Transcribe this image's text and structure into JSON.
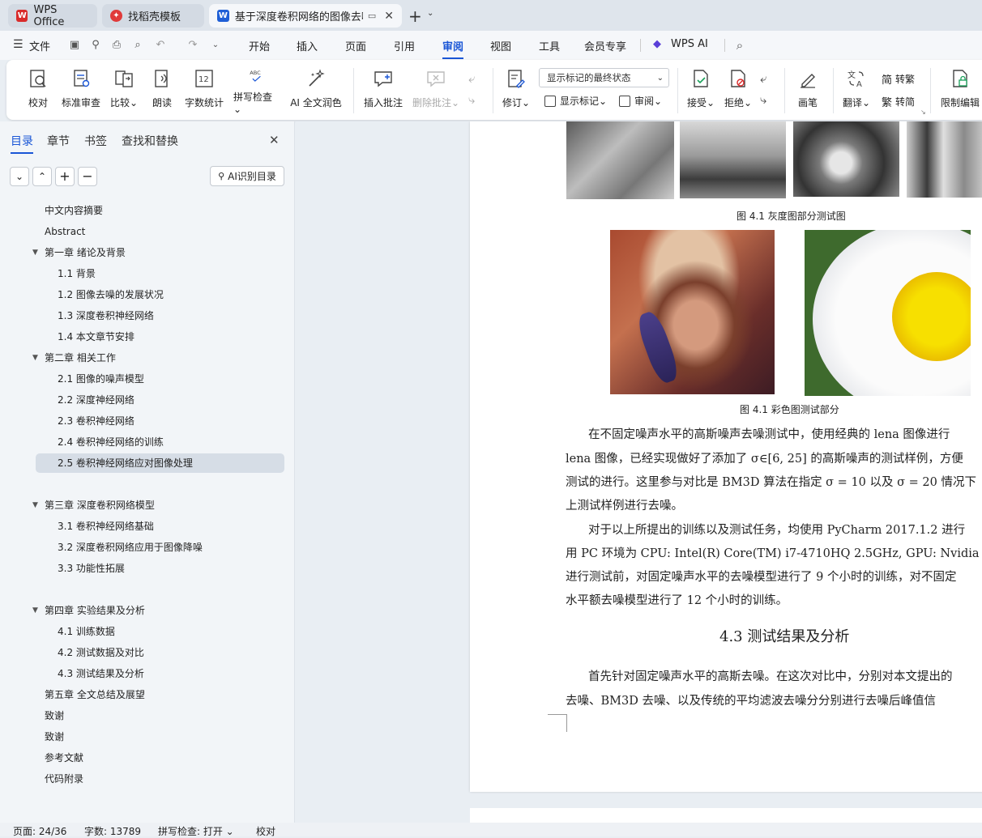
{
  "tabs": [
    {
      "label": "WPS Office",
      "icon": "wps-logo",
      "color": "#d92b2b"
    },
    {
      "label": "找稻壳模板",
      "icon": "docer-logo",
      "color": "#e03a3a"
    },
    {
      "label": "基于深度卷积网络的图像去噪",
      "icon": "word-logo",
      "color": "#1f5fd6"
    }
  ],
  "menu": {
    "file": "文件",
    "items": [
      "开始",
      "插入",
      "页面",
      "引用",
      "审阅",
      "视图",
      "工具",
      "会员专享"
    ],
    "selected": "审阅",
    "wps_ai": "WPS AI"
  },
  "ribbon": {
    "buttons": [
      "校对",
      "标准审查",
      "比较",
      "朗读",
      "字数统计",
      "拼写检查",
      "AI 全文润色",
      "插入批注",
      "删除批注",
      "修订",
      "画笔",
      "翻译",
      "限制编辑"
    ],
    "dropdown": "显示标记的最终状态",
    "small": [
      "显示标记",
      "审阅",
      "接受",
      "拒绝",
      "转繁",
      "转简"
    ]
  },
  "panel": {
    "tabs": [
      "目录",
      "章节",
      "书签",
      "查找和替换"
    ],
    "ai_button": "AI识别目录",
    "toc": [
      {
        "text": "中文内容摘要",
        "level": 1,
        "expand": false
      },
      {
        "text": "Abstract",
        "level": 1,
        "expand": false
      },
      {
        "text": "第一章  绪论及背景",
        "level": 1,
        "expand": true
      },
      {
        "text": "1.1 背景",
        "level": 2
      },
      {
        "text": "1.2  图像去噪的发展状况",
        "level": 2
      },
      {
        "text": "1.3  深度卷积神经网络",
        "level": 2
      },
      {
        "text": "1.4  本文章节安排",
        "level": 2
      },
      {
        "text": "第二章  相关工作",
        "level": 1,
        "expand": true
      },
      {
        "text": "2.1 图像的噪声模型",
        "level": 2
      },
      {
        "text": "2.2 深度神经网络",
        "level": 2
      },
      {
        "text": "2.3 卷积神经网络",
        "level": 2
      },
      {
        "text": "2.4  卷积神经网络的训练",
        "level": 2
      },
      {
        "text": "2.5  卷积神经网络应对图像处理",
        "level": 2,
        "selected": true
      },
      {
        "text": "第三章  深度卷积网络模型",
        "level": 1,
        "expand": true
      },
      {
        "text": "3.1  卷积神经网络基础",
        "level": 2
      },
      {
        "text": "3.2  深度卷积网络应用于图像降噪",
        "level": 2
      },
      {
        "text": "3.3  功能性拓展",
        "level": 2
      },
      {
        "text": "第四章  实验结果及分析",
        "level": 1,
        "expand": true
      },
      {
        "text": "4.1  训练数据",
        "level": 2
      },
      {
        "text": "4.2  测试数据及对比",
        "level": 2
      },
      {
        "text": "4.3  测试结果及分析",
        "level": 2
      },
      {
        "text": "第五章  全文总结及展望",
        "level": 1,
        "expand": false
      },
      {
        "text": "致谢",
        "level": 1,
        "expand": false
      },
      {
        "text": "致谢",
        "level": 1,
        "expand": false
      },
      {
        "text": "参考文献",
        "level": 1,
        "expand": false
      },
      {
        "text": "代码附录",
        "level": 1,
        "expand": false
      }
    ]
  },
  "document": {
    "caption1": "图 4.1  灰度图部分测试图",
    "caption2": "图  4.1  彩色图测试部分",
    "paragraphs": [
      "在不固定噪声水平的高斯噪声去噪测试中，使用经典的 lena 图像进行",
      "lena 图像，已经实现做好了添加了 σ∈[6, 25] 的高斯噪声的测试样例，方便",
      "测试的进行。这里参与对比是 BM3D 算法在指定 σ = 10 以及 σ = 20 情况下",
      "上测试样例进行去噪。",
      "对于以上所提出的训练以及测试任务，均使用 PyCharm 2017.1.2 进行",
      "用 PC 环境为 CPU: Intel(R) Core(TM) i7-4710HQ 2.5GHz, GPU: Nvidia GTX",
      "进行测试前，对固定噪声水平的去噪模型进行了 9 个小时的训练，对不固定",
      "水平额去噪模型进行了 12 个小时的训练。",
      "首先针对固定噪声水平的高斯去噪。在这次对比中，分别对本文提出的",
      "去噪、BM3D 去噪、以及传统的平均滤波去噪分分别进行去噪后峰值信"
    ],
    "heading": "4.3  测试结果及分析"
  },
  "status": {
    "page": "页面: 24/36",
    "words": "字数: 13789",
    "spell": "拼写检查: 打开",
    "proof": "校对"
  }
}
